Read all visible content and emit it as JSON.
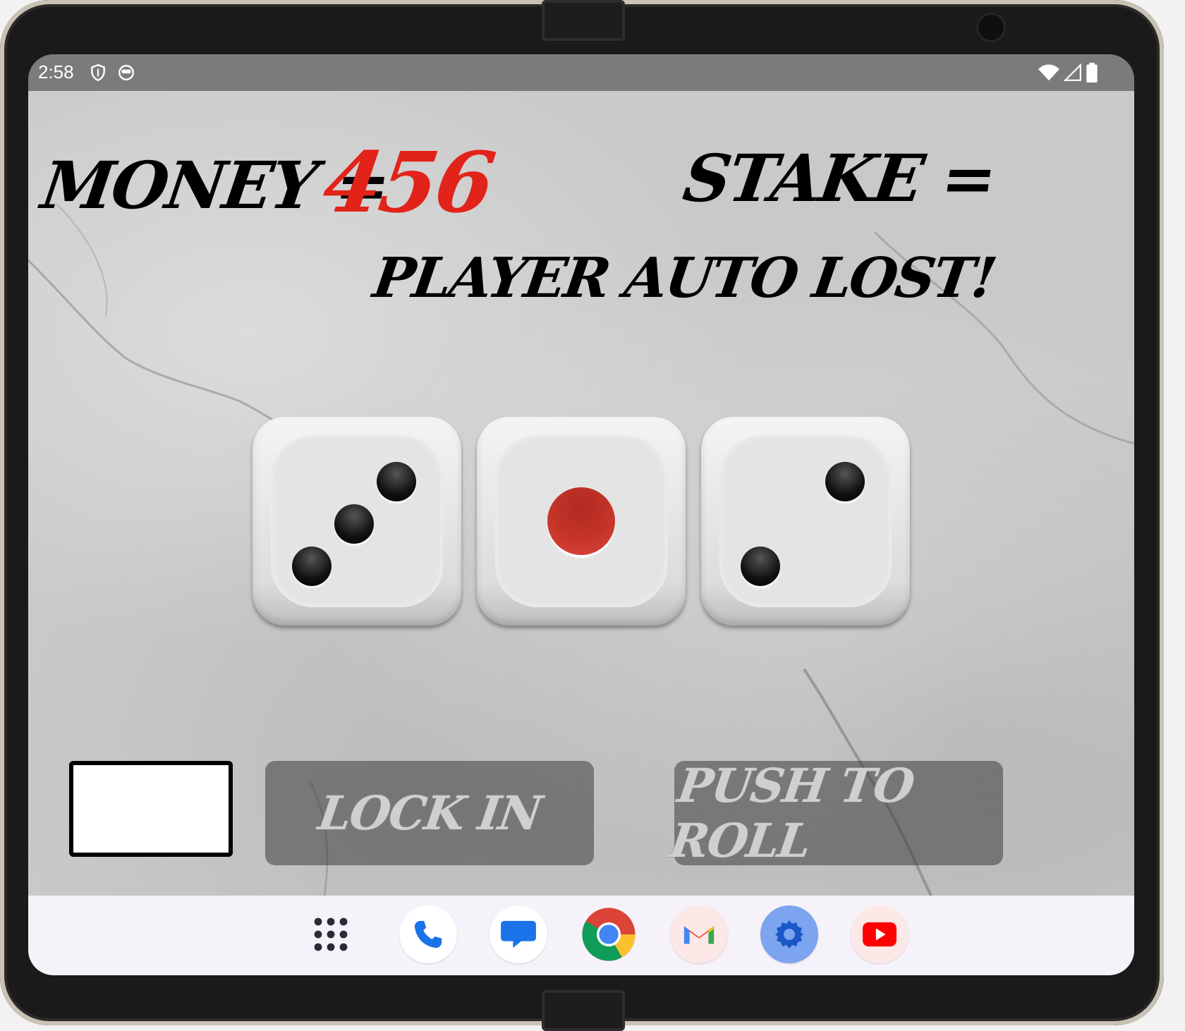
{
  "status_bar": {
    "time": "2:58",
    "icons": [
      "shield-icon",
      "face-icon",
      "wifi-icon",
      "signal-icon",
      "battery-icon"
    ]
  },
  "game": {
    "money_label": "MONEY =",
    "money_value": "456",
    "stake_label": "STAKE =",
    "message": "PLAYER AUTO LOST!",
    "dice": [
      3,
      1,
      2
    ],
    "stake_input_value": "",
    "lock_in_label": "LOCK IN",
    "roll_label": "PUSH TO ROLL",
    "colors": {
      "money_value": "#e2231a",
      "button_text": "#cfcfcf"
    }
  },
  "dock": {
    "apps": [
      "app-drawer-icon",
      "phone-icon",
      "messages-icon",
      "chrome-icon",
      "gmail-icon",
      "settings-icon",
      "youtube-icon"
    ]
  }
}
